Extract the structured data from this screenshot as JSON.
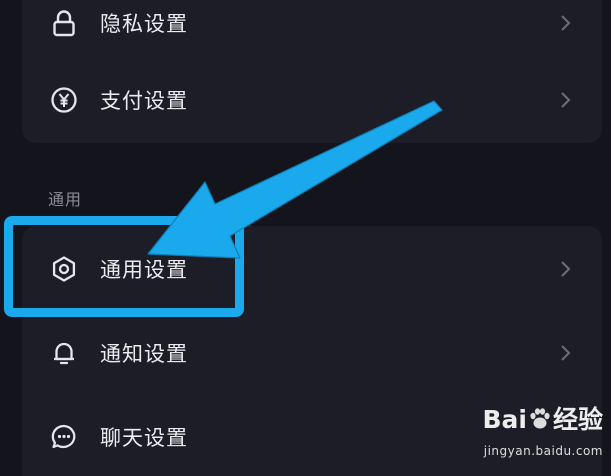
{
  "settings": {
    "privacy": {
      "label": "隐私设置",
      "icon": "lock-icon"
    },
    "payment": {
      "label": "支付设置",
      "icon": "yen-circle-icon"
    },
    "section_general": {
      "title": "通用"
    },
    "general": {
      "label": "通用设置",
      "icon": "gear-icon"
    },
    "notify": {
      "label": "通知设置",
      "icon": "bell-icon"
    },
    "chat": {
      "label": "聊天设置",
      "icon": "chat-bubble-icon"
    }
  },
  "annotation": {
    "highlight_color": "#1aa9ec",
    "arrow_color": "#1aa9ec"
  },
  "watermark": {
    "brand_left": "Bai",
    "brand_right": "经验",
    "url": "jingyan.baidu.com"
  }
}
